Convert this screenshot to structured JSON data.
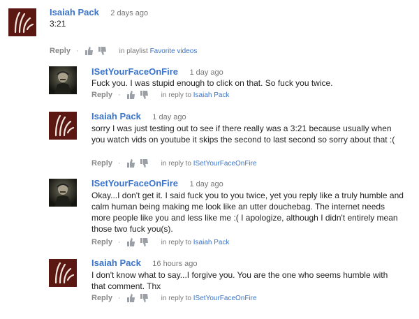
{
  "comments": [
    {
      "author": "Isaiah Pack",
      "time": "2 days ago",
      "text": "3:21",
      "reply_label": "Reply",
      "ctx_prefix": "in playlist",
      "ctx_link": "Favorite videos",
      "avatar": "isaiah-avatar"
    },
    {
      "author": "ISetYourFaceOnFire",
      "time": "1 day ago",
      "text": "Fuck you. I was stupid enough to click on that. So fuck you twice.",
      "reply_label": "Reply",
      "ctx_prefix": "in reply to",
      "ctx_link": "Isaiah Pack",
      "avatar": "isetyourfaceonfire-avatar"
    },
    {
      "author": "Isaiah Pack",
      "time": "1 day ago",
      "text": "sorry I was just testing out to see if there really was a 3:21 because usually when you watch vids on youtube it skips the second to last second so sorry about that :(",
      "reply_label": "Reply",
      "ctx_prefix": "in reply to",
      "ctx_link": "ISetYourFaceOnFire",
      "avatar": "isaiah-avatar"
    },
    {
      "author": "ISetYourFaceOnFire",
      "time": "1 day ago",
      "text": "Okay...I don't get it. I said fuck you to you twice, yet you reply like a truly humble and calm human being making me look like an utter douchebag. The internet needs more people like you and less like me :( I apologize, although I didn't entirely mean those two fuck you(s).",
      "reply_label": "Reply",
      "ctx_prefix": "in reply to",
      "ctx_link": "Isaiah Pack",
      "avatar": "isetyourfaceonfire-avatar"
    },
    {
      "author": "Isaiah Pack",
      "time": "16 hours ago",
      "text": "I don't know what to say...I forgive you. You are the one who seems humble with that comment. Thx",
      "reply_label": "Reply",
      "ctx_prefix": "in reply to",
      "ctx_link": "ISetYourFaceOnFire",
      "avatar": "isaiah-avatar"
    }
  ],
  "icons": {
    "like": "thumbs-up-icon",
    "dislike": "thumbs-down-icon",
    "separator": "·"
  },
  "colors": {
    "author": "#3b74c9",
    "isaiah_avatar_bg": "#5b1712",
    "meta": "#777777"
  }
}
